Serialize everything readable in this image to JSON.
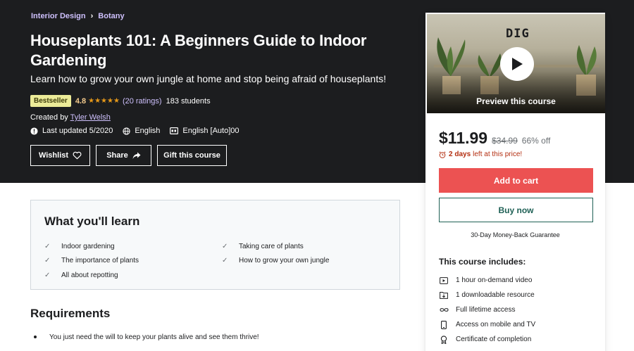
{
  "breadcrumb": [
    {
      "label": "Interior Design"
    },
    {
      "label": "Botany"
    }
  ],
  "course": {
    "title": "Houseplants 101: A Beginners Guide to Indoor Gardening",
    "subtitle": "Learn how to grow your own jungle at home and stop being afraid of houseplants!",
    "badge": "Bestseller",
    "rating": "4.8",
    "stars": "★★★★★",
    "ratings_count": "(20 ratings)",
    "students": "183 students",
    "created_prefix": "Created by",
    "author": "Tyler Welsh",
    "last_updated": "Last updated 5/2020",
    "language": "English",
    "captions": "English [Auto]00"
  },
  "actions": {
    "wishlist": "Wishlist",
    "share": "Share",
    "gift": "Gift this course"
  },
  "card": {
    "logo_text": "DIG",
    "preview_label": "Preview this course",
    "price": "$11.99",
    "original_price": "$34.99",
    "discount": "66% off",
    "timer_days": "2 days",
    "timer_rest": "left at this price!",
    "add_to_cart": "Add to cart",
    "buy_now": "Buy now",
    "guarantee": "30-Day Money-Back Guarantee",
    "includes_title": "This course includes:",
    "includes": [
      {
        "icon": "video-icon",
        "text": "1 hour on-demand video"
      },
      {
        "icon": "download-file-icon",
        "text": "1 downloadable resource"
      },
      {
        "icon": "infinity-icon",
        "text": "Full lifetime access"
      },
      {
        "icon": "mobile-icon",
        "text": "Access on mobile and TV"
      },
      {
        "icon": "certificate-icon",
        "text": "Certificate of completion"
      }
    ]
  },
  "learn": {
    "title": "What you'll learn",
    "left": [
      "Indoor gardening",
      "The importance of plants",
      "All about repotting"
    ],
    "right": [
      "Taking care of plants",
      "How to grow your own jungle"
    ]
  },
  "requirements": {
    "title": "Requirements",
    "items": [
      "You just need the will to keep your plants alive and see them thrive!"
    ]
  },
  "colors": {
    "hero_bg": "#1c1d1f",
    "accent_purple": "#cec0fc",
    "cart_red": "#ec5252",
    "buy_green": "#1e6055",
    "badge_yellow": "#eceb98",
    "star_orange": "#e59819",
    "timer_red": "#b32d0f"
  }
}
